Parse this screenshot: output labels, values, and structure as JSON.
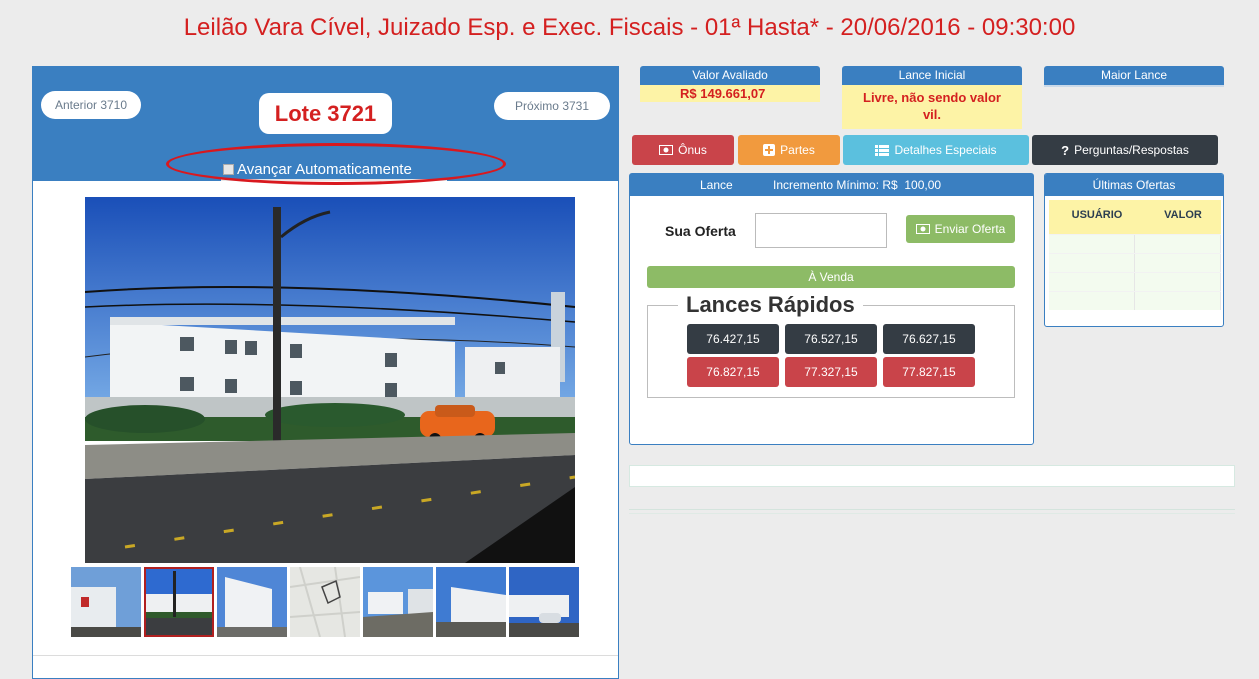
{
  "page": {
    "title": "Leilão Vara Cível, Juizado Esp. e Exec. Fiscais - 01ª Hasta* - 20/06/2016 - 09:30:00"
  },
  "lot_nav": {
    "previous_label": "Anterior 3710",
    "lot_label": "Lote 3721",
    "next_label": "Próximo 3731",
    "auto_advance_label": "Avançar Automaticamente"
  },
  "stats": {
    "avaliado": {
      "label": "Valor Avaliado",
      "value": "R$ 149.661,07"
    },
    "inicial": {
      "label": "Lance Inicial",
      "value": "Livre, não sendo valor vil."
    },
    "maior": {
      "label": "Maior Lance"
    }
  },
  "actions": {
    "onus": "Ônus",
    "partes": "Partes",
    "detalhes": "Detalhes Especiais",
    "perguntas": "Perguntas/Respostas"
  },
  "bid": {
    "header_left": "Lance",
    "header_right": "Incremento Mínimo: R$  100,00",
    "offer_label": "Sua Oferta",
    "offer_value": "",
    "send_label": "Enviar Oferta",
    "status": "À Venda",
    "quick_title": "Lances Rápidos",
    "quick_bids": [
      "76.427,15",
      "76.527,15",
      "76.627,15",
      "76.827,15",
      "77.327,15",
      "77.827,15"
    ]
  },
  "offers": {
    "title": "Últimas Ofertas",
    "col_user": "USUÁRIO",
    "col_value": "VALOR"
  },
  "colors": {
    "title_red": "#d42020",
    "panel_blue": "#3a7fc1",
    "highlight_yellow": "#fdf3a6",
    "button_red": "#c9444a",
    "button_orange": "#f19a3e",
    "button_cyan": "#5bc0de",
    "button_dark": "#343c44",
    "button_green": "#8dbb66"
  },
  "icons": {
    "onus": "money-icon",
    "partes": "plus-square-icon",
    "detalhes": "list-icon",
    "perguntas": "question-icon",
    "enviar": "money-icon"
  }
}
